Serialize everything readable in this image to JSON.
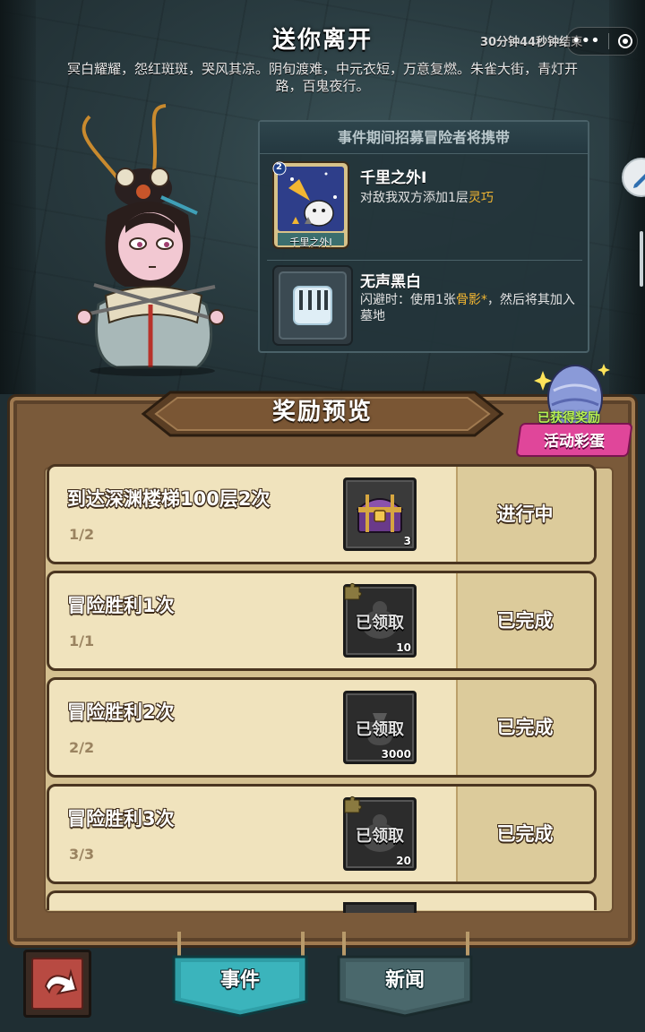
{
  "event": {
    "title": "送你离开",
    "timer": "30分钟44秒钟结束",
    "description": "冥白耀耀，怨红斑斑，哭风其凉。阴旬渡难，中元衣短，万意复燃。朱雀大街，青灯开路，百鬼夜行。"
  },
  "capsule": {
    "more_icon": "more-dots-icon",
    "close_icon": "target-icon"
  },
  "carry": {
    "header": "事件期间招募冒险者将携带",
    "items": [
      {
        "name": "千里之外I",
        "card_label": "千里之外I",
        "card_level": "2",
        "desc_prefix": "对敌我双方添加1层",
        "desc_highlight": "灵巧",
        "desc_suffix": ""
      },
      {
        "name": "无声黑白",
        "desc_prefix": "闪避时：使用1张",
        "desc_highlight": "骨影*",
        "desc_suffix": "，然后将其加入墓地"
      }
    ]
  },
  "board": {
    "title": "奖励预览",
    "egg_badge": {
      "got": "已获得奖励",
      "label": "活动彩蛋"
    }
  },
  "rewards": [
    {
      "task": "到达深渊楼梯100层2次",
      "progress": "1/2",
      "status": "进行中",
      "claimed_label": "",
      "qty": "3",
      "icon": "treasure-chest-icon"
    },
    {
      "task": "冒险胜利1次",
      "progress": "1/1",
      "status": "已完成",
      "claimed_label": "已领取",
      "qty": "10",
      "icon": "puzzle-piece-icon"
    },
    {
      "task": "冒险胜利2次",
      "progress": "2/2",
      "status": "已完成",
      "claimed_label": "已领取",
      "qty": "3000",
      "icon": "money-bag-icon"
    },
    {
      "task": "冒险胜利3次",
      "progress": "3/3",
      "status": "已完成",
      "claimed_label": "已领取",
      "qty": "20",
      "icon": "puzzle-piece-icon"
    }
  ],
  "nav": {
    "event_tab": "事件",
    "news_tab": "新闻",
    "back_icon": "back-arrow-icon"
  },
  "colors": {
    "highlight": "#f2b632",
    "tab_active": "#2f9fa7",
    "tab_inactive": "#3f5a5e",
    "egg_ribbon": "#e0469a"
  }
}
